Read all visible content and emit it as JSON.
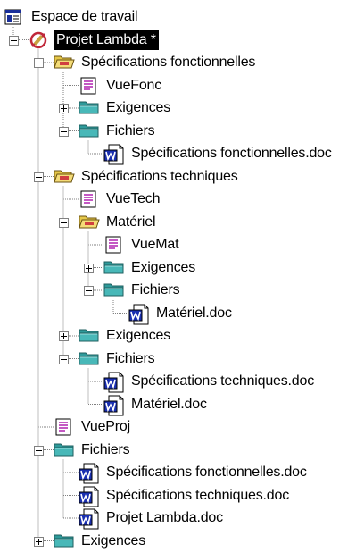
{
  "tree": [
    {
      "label": "Espace de travail",
      "icon": "workspace-icon",
      "level": 0
    },
    {
      "label": "Projet Lambda *",
      "icon": "project-icon",
      "level": 1,
      "expander": "minus",
      "selected": true
    },
    {
      "label": "Spécifications fonctionnelles",
      "icon": "open-folder-icon",
      "level": 2,
      "expander": "minus"
    },
    {
      "label": "VueFonc",
      "icon": "view-icon",
      "level": 3
    },
    {
      "label": "Exigences",
      "icon": "folder-icon",
      "level": 3,
      "expander": "plus"
    },
    {
      "label": "Fichiers",
      "icon": "folder-icon",
      "level": 3,
      "expander": "minus"
    },
    {
      "label": "Spécifications fonctionnelles.doc",
      "icon": "word-doc-icon",
      "level": 4
    },
    {
      "label": "Spécifications techniques",
      "icon": "open-folder-icon",
      "level": 2,
      "expander": "minus"
    },
    {
      "label": "VueTech",
      "icon": "view-icon",
      "level": 3
    },
    {
      "label": "Matériel",
      "icon": "open-folder-icon",
      "level": 3,
      "expander": "minus"
    },
    {
      "label": "VueMat",
      "icon": "view-icon",
      "level": 4
    },
    {
      "label": "Exigences",
      "icon": "folder-icon",
      "level": 4,
      "expander": "plus"
    },
    {
      "label": "Fichiers",
      "icon": "folder-icon",
      "level": 4,
      "expander": "minus"
    },
    {
      "label": "Matériel.doc",
      "icon": "word-doc-icon",
      "level": 5
    },
    {
      "label": "Exigences",
      "icon": "folder-icon",
      "level": 3,
      "expander": "plus"
    },
    {
      "label": "Fichiers",
      "icon": "folder-icon",
      "level": 3,
      "expander": "minus"
    },
    {
      "label": "Spécifications techniques.doc",
      "icon": "word-doc-icon",
      "level": 4
    },
    {
      "label": "Matériel.doc",
      "icon": "word-doc-icon",
      "level": 4
    },
    {
      "label": "VueProj",
      "icon": "view-icon",
      "level": 2
    },
    {
      "label": "Fichiers",
      "icon": "folder-icon",
      "level": 2,
      "expander": "minus"
    },
    {
      "label": "Spécifications fonctionnelles.doc",
      "icon": "word-doc-icon",
      "level": 3
    },
    {
      "label": "Spécifications techniques.doc",
      "icon": "word-doc-icon",
      "level": 3
    },
    {
      "label": "Projet Lambda.doc",
      "icon": "word-doc-icon",
      "level": 3
    },
    {
      "label": "Exigences",
      "icon": "folder-icon",
      "level": 2,
      "expander": "plus"
    }
  ],
  "colors": {
    "selection_bg": "#000000",
    "tree_lines": "#808080",
    "folder_teal": "#2e9a9a",
    "folder_yellow": "#e6c84a",
    "doc_blue": "#1a2fb0",
    "project_red": "#c0283a"
  }
}
